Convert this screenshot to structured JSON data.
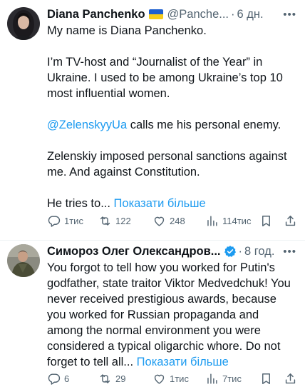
{
  "tweets": [
    {
      "author": "Diana Panchenko",
      "handle": "@Panche...",
      "dot": "·",
      "time": "6 дн.",
      "more": "•••",
      "paragraphs": [
        "My name is Diana Panchenko.",
        "I’m TV-host and “Journalist of the Year” in Ukraine. I used to be among Ukraine’s top 10 most influential women.",
        "calls me his personal enemy.",
        "Zelenskiy imposed personal sanctions against me. And against Constitution.",
        "He tries to..."
      ],
      "mention": "@ZelenskyyUa",
      "show_more": "Показати більше",
      "stats": {
        "replies": "1тис",
        "reposts": "122",
        "likes": "248",
        "views": "114тис"
      }
    },
    {
      "author": "Симороз Олег Олександров...",
      "dot": "·",
      "time": "8 год.",
      "more": "•••",
      "text": "You forgot to tell how you worked for Putin's godfather, state traitor Viktor Medvedchuk! You never received prestigious awards, because you worked for Russian propaganda and among the normal environment you were considered a typical oligarchic whore. Do not forget to tell all...",
      "show_more": "Показати більше",
      "stats": {
        "replies": "6",
        "reposts": "29",
        "likes": "1тис",
        "views": "7тис"
      }
    }
  ],
  "icons": {
    "reply": "reply-icon",
    "repost": "repost-icon",
    "like": "like-icon",
    "views": "views-icon",
    "bookmark": "bookmark-icon",
    "share": "share-icon",
    "verified": "verified-badge-icon",
    "flag": "ukraine-flag-icon"
  },
  "colors": {
    "accent": "#1d9bf0",
    "secondary_text": "#536471",
    "divider": "#eff3f4"
  }
}
